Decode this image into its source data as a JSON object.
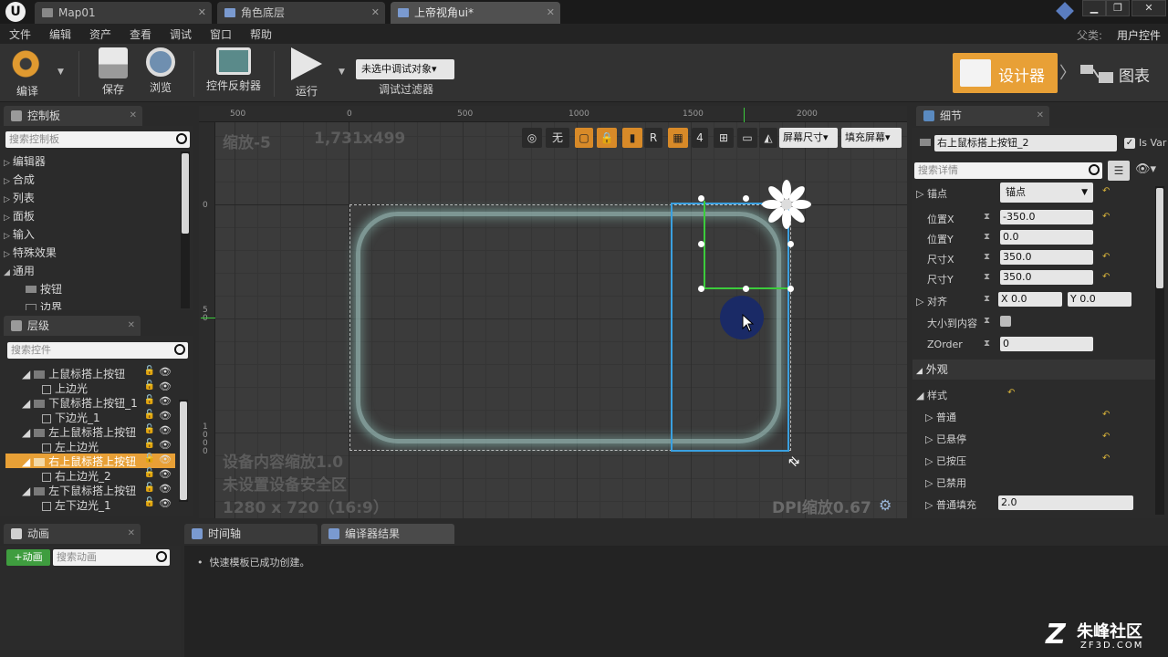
{
  "tabs": [
    {
      "label": "Map01"
    },
    {
      "label": "角色底层"
    },
    {
      "label": "上帝视角ui*"
    }
  ],
  "menu": [
    "文件",
    "编辑",
    "资产",
    "查看",
    "调试",
    "窗口",
    "帮助"
  ],
  "parent": {
    "label": "父类:",
    "value": "用户控件"
  },
  "toolbar": {
    "compile": "编译",
    "save": "保存",
    "browse": "浏览",
    "reflector": "控件反射器",
    "run": "运行",
    "debug_select": "未选中调试对象▾",
    "debug_filter": "调试过滤器",
    "designer": "设计器",
    "graph": "图表"
  },
  "palette": {
    "title": "控制板",
    "search_placeholder": "搜索控制板",
    "categories": [
      "编辑器",
      "合成",
      "列表",
      "面板",
      "输入",
      "特殊效果",
      "通用"
    ],
    "items": [
      "按钮",
      "边界"
    ]
  },
  "hierarchy": {
    "title": "层级",
    "search_placeholder": "搜索控件",
    "rows": [
      {
        "label": "上鼠标搭上按钮"
      },
      {
        "label": "上边光"
      },
      {
        "label": "下鼠标搭上按钮_1"
      },
      {
        "label": "下边光_1"
      },
      {
        "label": "左上鼠标搭上按钮"
      },
      {
        "label": "左上边光"
      },
      {
        "label": "右上鼠标搭上按钮"
      },
      {
        "label": "右上边光_2"
      },
      {
        "label": "左下鼠标搭上按钮"
      },
      {
        "label": "左下边光_1"
      }
    ]
  },
  "canvas": {
    "ruler_ticks": [
      "500",
      "0",
      "500",
      "1000",
      "1500",
      "2000"
    ],
    "ruler_v_ticks": [
      "0",
      "5\n0",
      "1\n0\n0\n0"
    ],
    "zoom": "缩放-5",
    "size": "1,731x499",
    "device_scale": "设备内容缩放1.0",
    "safe_zone": "未设置设备安全区",
    "resolution": "1280 x 720（16:9）",
    "dpi": "DPI缩放0.67",
    "tool_none": "无",
    "tool_r": "R",
    "tool_4": "4",
    "screen_size": "屏幕尺寸▾",
    "fill_screen": "填充屏幕▾"
  },
  "details": {
    "title": "细节",
    "widget_name": "右上鼠标搭上按钮_2",
    "is_variable": "Is Var",
    "search_placeholder": "搜索详情",
    "anchor_label": "锚点",
    "anchor_value": "锚点",
    "pos_x_label": "位置X",
    "pos_x": "-350.0",
    "pos_y_label": "位置Y",
    "pos_y": "0.0",
    "size_x_label": "尺寸X",
    "size_x": "350.0",
    "size_y_label": "尺寸Y",
    "size_y": "350.0",
    "align_label": "对齐",
    "align_x": "X 0.0",
    "align_y": "Y 0.0",
    "size_to_content": "大小到内容",
    "zorder_label": "ZOrder",
    "zorder": "0",
    "appearance": "外观",
    "style": "样式",
    "normal": "普通",
    "hovered": "已悬停",
    "pressed": "已按压",
    "disabled": "已禁用",
    "normal_padding": "普通填充",
    "normal_padding_value": "2.0"
  },
  "bottom": {
    "animation_tab": "动画",
    "add_animation": "+动画",
    "search_animation": "搜索动画",
    "timeline_tab": "时间轴",
    "compiler_tab": "编译器结果",
    "log": "快速模板已成功创建。"
  },
  "watermark": {
    "brand": "朱峰社区",
    "site": "ZF3D.COM"
  },
  "colors": {
    "accent": "#e8a036",
    "selection": "#3aa0e0",
    "anchor_green": "#3ccc3c"
  }
}
